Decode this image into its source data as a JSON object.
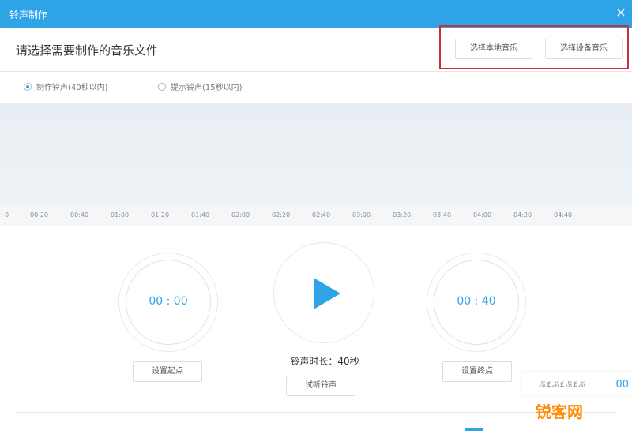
{
  "window": {
    "title": "铃声制作",
    "close_glyph": "×"
  },
  "header": {
    "prompt": "请选择需要制作的音乐文件",
    "btn_local": "选择本地音乐",
    "btn_device": "选择设备音乐"
  },
  "options": [
    {
      "label": "制作铃声(40秒以内)",
      "selected": true
    },
    {
      "label": "提示铃声(15秒以内)",
      "selected": false
    }
  ],
  "timeline": {
    "ticks": [
      "0",
      "00:20",
      "00:40",
      "01:00",
      "01:20",
      "01:40",
      "02:00",
      "02:20",
      "02:40",
      "03:00",
      "03:20",
      "03:40",
      "04:00",
      "04:20",
      "04:40"
    ]
  },
  "player": {
    "start_time": "00 : 00",
    "end_time": "00 : 40",
    "duration_label": "铃声时长：40秒",
    "btn_set_start": "设置起点",
    "btn_set_end": "设置终点",
    "btn_listen": "试听铃声"
  },
  "float_widget": {
    "text": "ぷ£ぷ£ぷ£ぷ",
    "corner": "00"
  },
  "watermark": {
    "text": "锐客网"
  },
  "colors": {
    "accent": "#2ea3e6",
    "highlight": "#c8313a",
    "watermark": "#ff8a00"
  },
  "icons": {
    "play": "play-triangle-icon",
    "close": "close-icon"
  }
}
